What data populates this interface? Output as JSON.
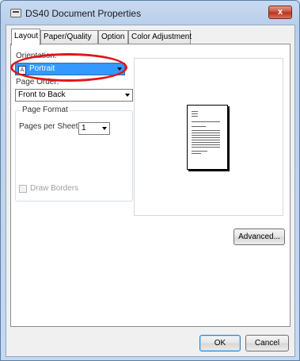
{
  "window": {
    "title": "DS40 Document Properties",
    "close_glyph": "x"
  },
  "tabs": [
    {
      "label": "Layout",
      "active": true
    },
    {
      "label": "Paper/Quality",
      "active": false
    },
    {
      "label": "Option",
      "active": false
    },
    {
      "label": "Color Adjustment",
      "active": false
    }
  ],
  "layout": {
    "orientation_label": "Orientation:",
    "orientation_value": "Portrait",
    "orientation_icon_glyph": "A",
    "page_order_label": "Page Order:",
    "page_order_value": "Front to Back",
    "page_format_title": "Page Format",
    "pages_per_sheet_label": "Pages per Sheet",
    "pages_per_sheet_value": "1",
    "draw_borders_label": "Draw Borders"
  },
  "buttons": {
    "advanced": "Advanced...",
    "ok": "OK",
    "cancel": "Cancel"
  },
  "colors": {
    "annotation": "#e0161b",
    "selection": "#3399ff"
  }
}
